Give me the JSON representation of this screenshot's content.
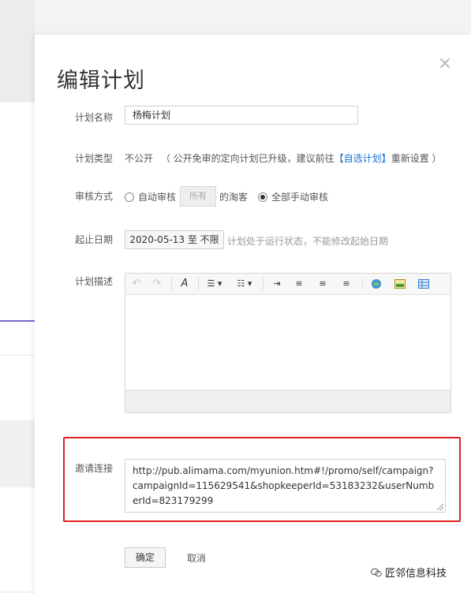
{
  "dialog": {
    "title": "编辑计划",
    "close_glyph": "×"
  },
  "form": {
    "name": {
      "label": "计划名称",
      "value": "杨梅计划"
    },
    "type": {
      "label": "计划类型",
      "value": "不公开",
      "note_prefix": "（ 公开免审的定向计划已升级，建议前往",
      "link_text": "【自选计划】",
      "note_suffix": "重新设置 ）"
    },
    "review": {
      "label": "审核方式",
      "option_auto": "自动审核",
      "auto_select": "所有",
      "auto_suffix": "的淘客",
      "option_manual": "全部手动审核",
      "selected": "全部手动审核"
    },
    "dates": {
      "label": "起止日期",
      "value": "2020-05-13 至 不限",
      "note": "计划处于运行状态，不能修改起始日期"
    },
    "description": {
      "label": "计划描述",
      "toolbar_icons": [
        "undo-icon",
        "redo-icon",
        "clear-format-icon",
        "bullet-list-icon",
        "numbered-list-icon",
        "indent-icon",
        "align-left-icon",
        "align-center-icon",
        "align-right-icon",
        "link-icon",
        "image-icon",
        "table-icon"
      ]
    },
    "invite": {
      "label": "邀请连接",
      "value": "http://pub.alimama.com/myunion.htm#!/promo/self/campaign?campaignId=115629541&shopkeeperId=53183232&userNumberId=823179299"
    }
  },
  "actions": {
    "confirm": "确定",
    "cancel": "取消"
  },
  "watermark": "匠邻信息科技",
  "colors": {
    "highlight": "#e02020",
    "link": "#1a6fd4"
  }
}
